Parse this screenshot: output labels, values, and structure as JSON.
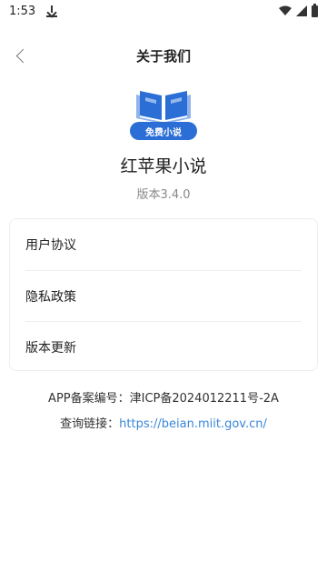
{
  "status_bar": {
    "time": "1:53",
    "icons": [
      "download-icon",
      "wifi-icon",
      "signal-icon",
      "battery-icon"
    ]
  },
  "header": {
    "title": "关于我们",
    "back_icon": "chevron-left-icon"
  },
  "app": {
    "logo_badge_text": "免费小说",
    "name": "红苹果小说",
    "version": "版本3.4.0"
  },
  "menu": {
    "items": [
      {
        "label": "用户协议"
      },
      {
        "label": "隐私政策"
      },
      {
        "label": "版本更新"
      }
    ]
  },
  "footer": {
    "icp_text": "APP备案编号：津ICP备2024012211号-2A",
    "query_label": "查询链接：",
    "query_link": "https://beian.miit.gov.cn/"
  },
  "colors": {
    "accent": "#2b6fd6",
    "link": "#3a87d9"
  }
}
